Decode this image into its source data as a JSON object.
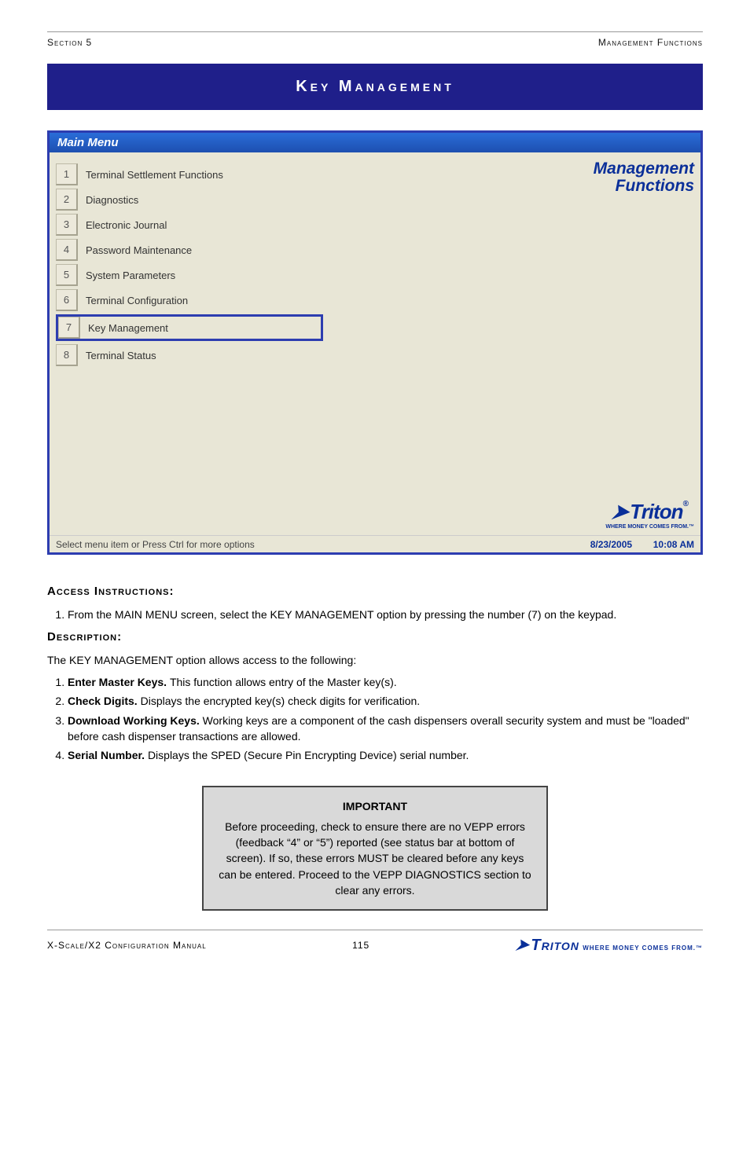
{
  "header": {
    "chapter": "Section 5",
    "title": "Management Functions"
  },
  "sectionBar": "Key Management",
  "screenshot": {
    "windowTitle": "Main Menu",
    "rightTitle1": "Management",
    "rightTitle2": "Functions",
    "menu": [
      {
        "key": "1",
        "label": "Terminal Settlement Functions",
        "highlight": false
      },
      {
        "key": "2",
        "label": "Diagnostics",
        "highlight": false
      },
      {
        "key": "3",
        "label": "Electronic Journal",
        "highlight": false
      },
      {
        "key": "4",
        "label": "Password Maintenance",
        "highlight": false
      },
      {
        "key": "5",
        "label": "System Parameters",
        "highlight": false
      },
      {
        "key": "6",
        "label": "Terminal Configuration",
        "highlight": false
      },
      {
        "key": "7",
        "label": "Key Management",
        "highlight": true
      },
      {
        "key": "8",
        "label": "Terminal Status",
        "highlight": false
      }
    ],
    "statusHelp": "Select menu item or Press Ctrl for more options",
    "statusDate": "8/23/2005",
    "statusTime": "10:08 AM",
    "logo": {
      "name": "Triton",
      "reg": "®",
      "tagline": "WHERE MONEY COMES FROM.™"
    }
  },
  "body": {
    "accessLabel": "Access Instructions:",
    "accessSteps": [
      "From the MAIN MENU screen, select the KEY MANAGEMENT option by pressing the number (7) on the keypad."
    ],
    "descLabel": "Description:",
    "descIntro": "The KEY MANAGEMENT option allows access to the following:",
    "descItems": [
      {
        "title": "Enter Master Keys.",
        "text": "This function allows entry of the Master key(s)."
      },
      {
        "title": "Check Digits.",
        "text": "Displays the encrypted key(s) check digits for verification."
      },
      {
        "title": "Download Working Keys.",
        "text": "Working keys are a component of the cash dispensers overall security system and must be \"loaded\" before cash dispenser transactions are allowed."
      },
      {
        "title": "Serial Number.",
        "text": "Displays the SPED (Secure Pin Encrypting Device) serial number."
      }
    ],
    "note": {
      "heading": "IMPORTANT",
      "text": "Before proceeding, check to ensure there are no VEPP errors (feedback “4” or “5”) reported (see status bar at bottom of screen). If so, these errors MUST be cleared before any keys can be entered. Proceed to the VEPP DIAGNOSTICS section to clear any errors."
    }
  },
  "footer": {
    "left": "X-Scale/X2 Configuration Manual",
    "page": "115",
    "logo": {
      "name": "Triton",
      "tagline": "WHERE MONEY COMES FROM.™"
    }
  }
}
